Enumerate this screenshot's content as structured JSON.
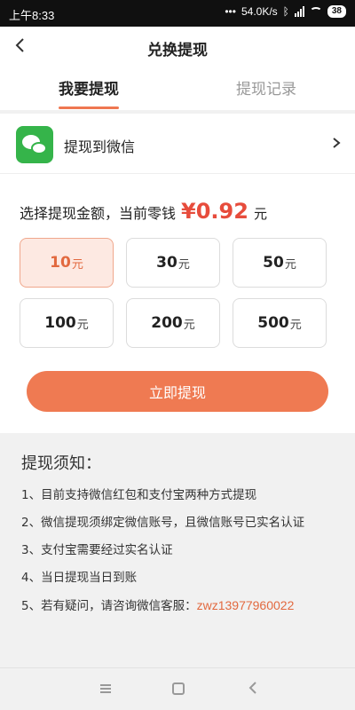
{
  "status": {
    "time": "上午8:33",
    "network_speed": "54.0K/s",
    "battery": "38"
  },
  "header": {
    "title": "兑换提现"
  },
  "tabs": [
    {
      "label": "我要提现",
      "active": true
    },
    {
      "label": "提现记录",
      "active": false
    }
  ],
  "method": {
    "label": "提现到微信",
    "icon": "wechat-logo"
  },
  "balance": {
    "prompt": "选择提现金额，当前零钱",
    "amount": "¥0.92",
    "unit": "元"
  },
  "options": [
    {
      "value": "10",
      "unit": "元",
      "selected": true
    },
    {
      "value": "30",
      "unit": "元",
      "selected": false
    },
    {
      "value": "50",
      "unit": "元",
      "selected": false
    },
    {
      "value": "100",
      "unit": "元",
      "selected": false
    },
    {
      "value": "200",
      "unit": "元",
      "selected": false
    },
    {
      "value": "500",
      "unit": "元",
      "selected": false
    }
  ],
  "submit_label": "立即提现",
  "notice": {
    "title": "提现须知：",
    "items": [
      "1、目前支持微信红包和支付宝两种方式提现",
      "2、微信提现须绑定微信账号，且微信账号已实名认证",
      "3、支付宝需要经过实名认证",
      "4、当日提现当日到账",
      "5、若有疑问，请咨询微信客服："
    ],
    "contact": "zwz13977960022"
  },
  "colors": {
    "accent": "#ef7751",
    "price_red": "#e74c3c",
    "wechat_green": "#35b44a"
  }
}
